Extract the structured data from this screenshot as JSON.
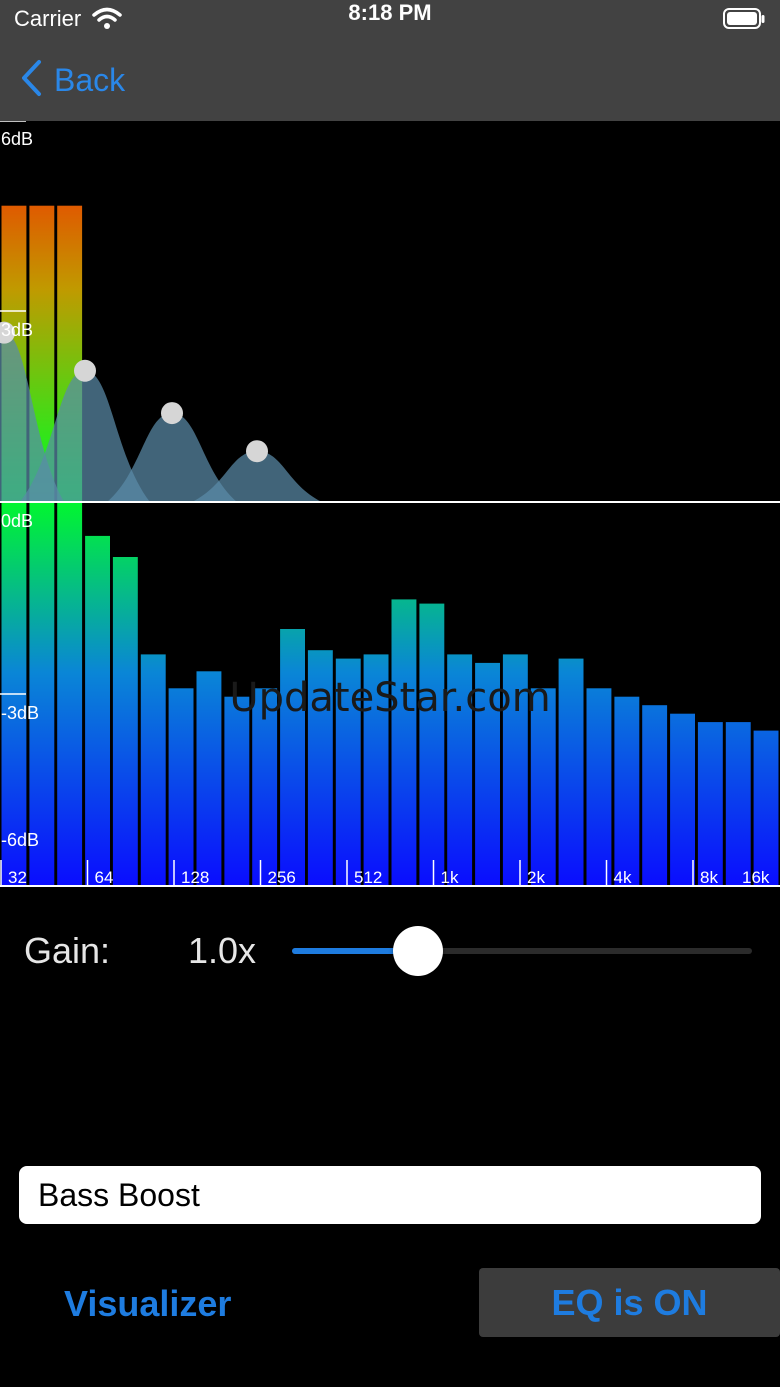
{
  "status_bar": {
    "carrier": "Carrier",
    "time": "8:18 PM"
  },
  "nav": {
    "back_label": "Back",
    "accent": "#2a87e8"
  },
  "visualizer": {
    "db_labels": [
      "6dB",
      "3dB",
      "0dB",
      "-3dB",
      "-6dB"
    ],
    "freq_labels": [
      "32",
      "64",
      "128",
      "256",
      "512",
      "1k",
      "2k",
      "4k",
      "8k",
      "16k"
    ],
    "bar_levels_db": [
      7,
      7,
      7,
      -0.8,
      -1.3,
      -3.6,
      -4.4,
      -4.0,
      -4.6,
      -4.4,
      -3.0,
      -3.5,
      -3.7,
      -3.6,
      -2.3,
      -2.4,
      -3.6,
      -3.8,
      -3.6,
      -4.4,
      -3.7,
      -4.4,
      -4.6,
      -4.8,
      -5.0,
      -5.2,
      -5.2,
      -5.4
    ],
    "eq_points_db": [
      4.0,
      3.1,
      2.1,
      1.2
    ],
    "watermark": "UpdateStar.com"
  },
  "gain": {
    "label": "Gain:",
    "value": "1.0x",
    "slider_fraction": 0.27
  },
  "preset": {
    "value": "Bass Boost"
  },
  "buttons": {
    "visualizer": "Visualizer",
    "eq_toggle": "EQ is ON"
  },
  "colors": {
    "accent": "#1e7ce0",
    "bar_top": "#00ff22",
    "bar_bottom": "#0a16ff",
    "bar_high": "#ff0000",
    "eq_fill": "#5a8aa8"
  }
}
